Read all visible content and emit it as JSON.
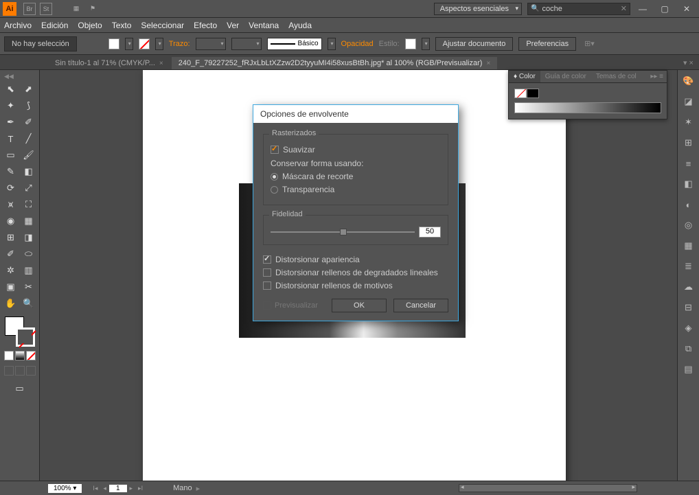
{
  "titlebar": {
    "logo": "Ai",
    "workspace": "Aspectos esenciales",
    "search_value": "coche"
  },
  "menu": [
    "Archivo",
    "Edición",
    "Objeto",
    "Texto",
    "Seleccionar",
    "Efecto",
    "Ver",
    "Ventana",
    "Ayuda"
  ],
  "control": {
    "no_selection": "No hay selección",
    "trazo": "Trazo:",
    "basico": "Básico",
    "opacidad": "Opacidad",
    "estilo": "Estilo:",
    "ajustar": "Ajustar documento",
    "prefs": "Preferencias"
  },
  "tabs": [
    {
      "label": "Sin título-1 al 71% (CMYK/P...",
      "active": false
    },
    {
      "label": "240_F_79227252_fRJxLbLtXZzw2D2tyyuMI4i58xusBtBh.jpg* al 100% (RGB/Previsualizar)",
      "active": true
    }
  ],
  "dialog": {
    "title": "Opciones de envolvente",
    "rasterizados": "Rasterizados",
    "suavizar": "Suavizar",
    "conservar": "Conservar forma usando:",
    "mascara": "Máscara de recorte",
    "transparencia": "Transparencia",
    "fidelidad": "Fidelidad",
    "fidelidad_val": "50",
    "dist_apariencia": "Distorsionar apariencia",
    "dist_degradados": "Distorsionar rellenos de degradados lineales",
    "dist_motivos": "Distorsionar rellenos de motivos",
    "previsualizar": "Previsualizar",
    "ok": "OK",
    "cancel": "Cancelar"
  },
  "color_panel": {
    "tabs": [
      "Color",
      "Guía de color",
      "Temas de col"
    ]
  },
  "status": {
    "zoom": "100%",
    "page": "1",
    "tool": "Mano"
  }
}
